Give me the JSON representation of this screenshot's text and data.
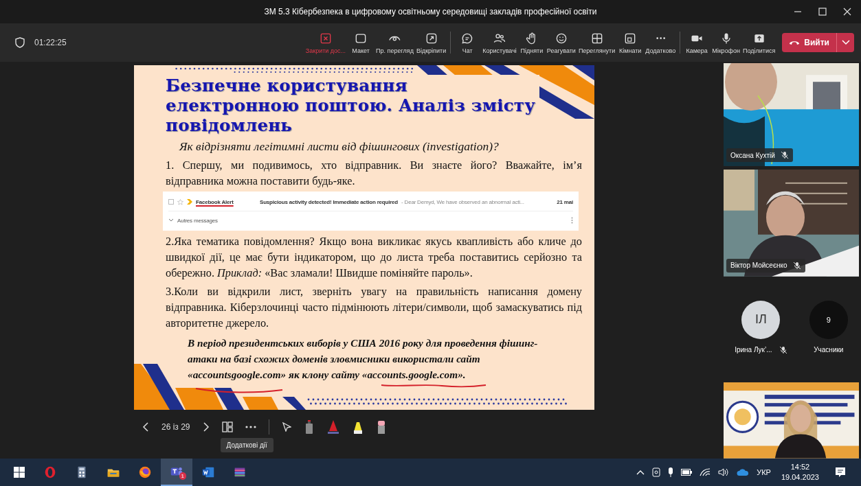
{
  "window": {
    "title": "ЗМ 5.3 Кібербезпека в цифровому освітньому середовищі закладів професійної освіти"
  },
  "toolbar": {
    "timer": "01:22:25",
    "groups": [
      [
        {
          "label": "Закрити дос...",
          "highlighted": true
        },
        {
          "label": "Макет",
          "highlighted": false
        },
        {
          "label": "Пр. перегляд",
          "highlighted": false
        },
        {
          "label": "Відкріпити",
          "highlighted": false
        }
      ],
      [
        {
          "label": "Чат",
          "highlighted": false
        },
        {
          "label": "Користувачі",
          "highlighted": false
        },
        {
          "label": "Підняти",
          "highlighted": false
        },
        {
          "label": "Реагувати",
          "highlighted": false
        },
        {
          "label": "Переглянути",
          "highlighted": false
        },
        {
          "label": "Кімнати",
          "highlighted": false
        },
        {
          "label": "Додатково",
          "highlighted": false
        }
      ],
      [
        {
          "label": "Камера",
          "highlighted": false
        },
        {
          "label": "Мікрофон",
          "highlighted": false
        },
        {
          "label": "Поділитися",
          "highlighted": false
        }
      ]
    ],
    "leave": {
      "label": "Вийти"
    }
  },
  "slide": {
    "title_lines": [
      "Безпечне користування",
      "електронною поштою. Аналіз змісту",
      "повідомлень"
    ],
    "subtitle": "Як відрізняти легітимні листи від фішингових (investigation)?",
    "paragraphs": [
      "1. Спершу, ми подивимось, хто відправник. Ви знаєте його? Вважайте, ім’я відправника можна поставити будь-яке."
    ],
    "email": {
      "sender": "Facebook Alert",
      "subject": "Suspicious activity detected! Immediate action required",
      "preview": "- Dear Demyd, We have observed an abnormal acti...",
      "date": "21 mai",
      "more": "Autres messages"
    },
    "paragraphs_after": [
      "2.Яка тематика повідомлення? Якщо вона викликає якусь квапливість або кличе до швидкої дії, це має бути індикатором, що до листа треба поставитись серйозно та обережно. *Приклад:* «Вас зламали! Швидше поміняйте пароль».",
      "3.Коли ви відкрили лист, зверніть увагу на правильність написання домену відправника. Кіберзлочинці часто підмінюють літери/символи, щоб замаскуватись під авторитетне джерело."
    ],
    "note": "В період президентських виборів у США 2016 року для проведення фішинг-атаки на базі схожих доменів зловмисники використали сайт «accountsgoogle.com» як клону сайту «accounts.google.com»."
  },
  "slide_controls": {
    "counter": "26 із 29",
    "tooltip": "Додаткові дії"
  },
  "participants": [
    {
      "kind": "video",
      "name": "Оксана Кухтій",
      "muted": true
    },
    {
      "kind": "video",
      "name": "Віктор Мойсеєнко",
      "muted": true
    }
  ],
  "avatars": [
    {
      "kind": "person",
      "initials": "ІЛ",
      "name": "Ірина Лук’...",
      "muted": true
    },
    {
      "kind": "overflow",
      "initials": "9",
      "name": "Учасники"
    }
  ],
  "taskbar": {
    "apps": [
      {
        "selected": false
      },
      {
        "selected": false
      },
      {
        "selected": false
      },
      {
        "selected": false
      },
      {
        "selected": true,
        "badge": "1"
      },
      {
        "selected": false
      },
      {
        "selected": false
      }
    ],
    "language": "УКР",
    "time": "14:52",
    "date": "19.04.2023"
  }
}
